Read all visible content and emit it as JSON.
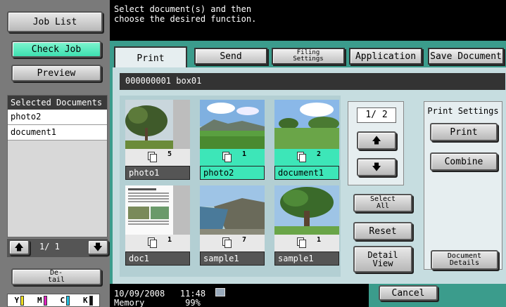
{
  "left": {
    "job_list": "Job List",
    "check_job": "Check Job",
    "preview": "Preview",
    "selected_header": "Selected Documents",
    "selected": [
      "photo2",
      "document1"
    ],
    "page_text": "1/ 1",
    "detail": "De-\ntail",
    "toner": [
      {
        "label": "Y",
        "color": "#f0e020"
      },
      {
        "label": "M",
        "color": "#e020c0"
      },
      {
        "label": "C",
        "color": "#20c0e0"
      },
      {
        "label": "K",
        "color": "#111111"
      }
    ]
  },
  "message": "Select document(s) and then\nchoose the desired function.",
  "tabs": {
    "print": "Print",
    "send": "Send",
    "filing": "Filing\nSettings",
    "application": "Application",
    "save_document": "Save Document"
  },
  "box": "000000001  box01",
  "thumbs": [
    {
      "name": "photo1",
      "count": "5",
      "selected": false
    },
    {
      "name": "photo2",
      "count": "1",
      "selected": true
    },
    {
      "name": "document1",
      "count": "2",
      "selected": true
    },
    {
      "name": "doc1",
      "count": "1",
      "selected": false
    },
    {
      "name": "sample1",
      "count": "7",
      "selected": false
    },
    {
      "name": "sample1",
      "count": "1",
      "selected": false
    }
  ],
  "pager": {
    "page": "1/ 2"
  },
  "actions": {
    "select_all": "Select\nAll",
    "reset": "Reset",
    "detail_view": "Detail\nView"
  },
  "print_settings": {
    "title": "Print Settings",
    "print": "Print",
    "combine": "Combine"
  },
  "document_details": "Document\nDetails",
  "status": {
    "datetime": "10/09/2008   11:48\nMemory        99%",
    "cancel": "Cancel"
  }
}
